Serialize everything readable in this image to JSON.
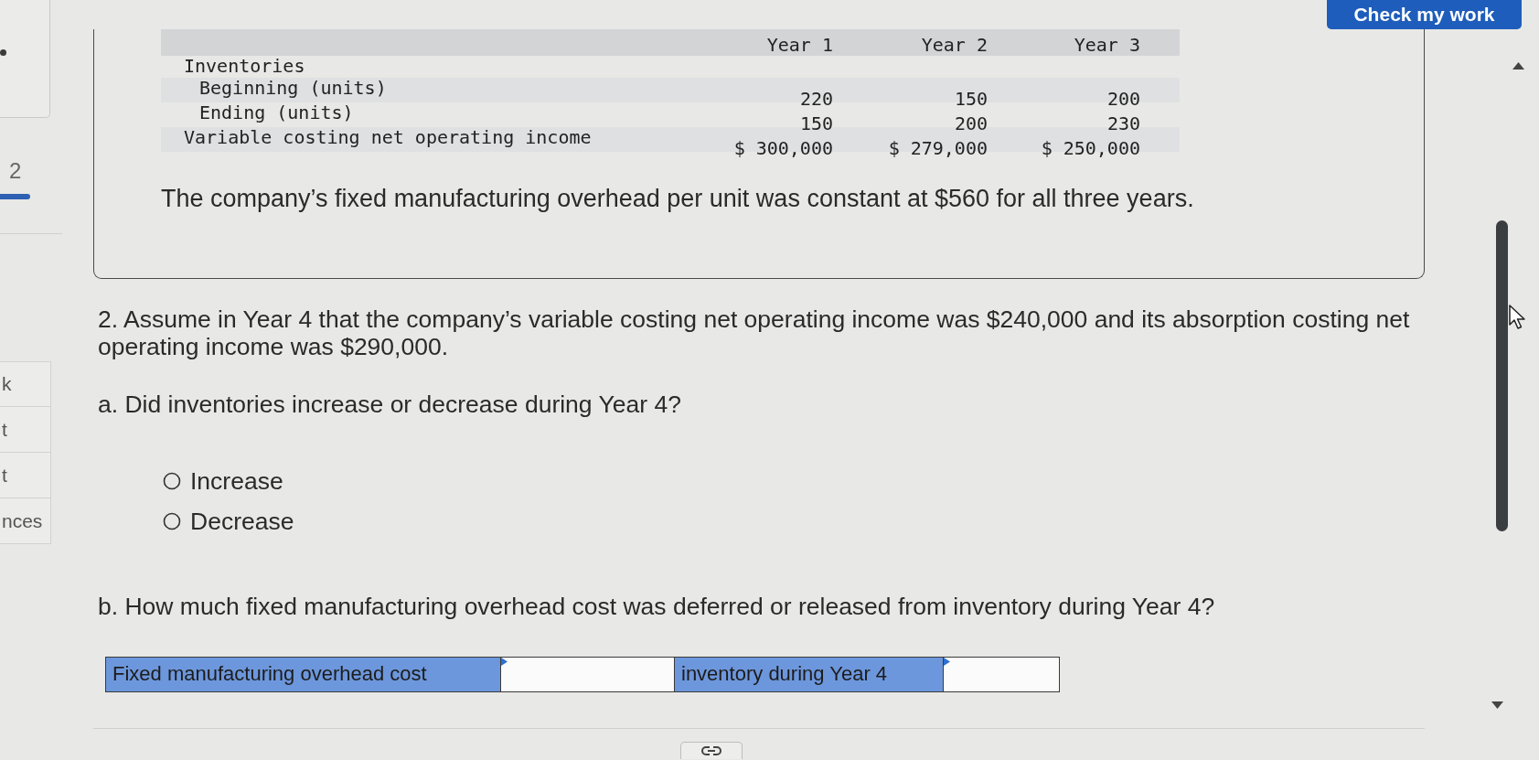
{
  "sidebar": {
    "page_indicator": "2",
    "links": [
      {
        "label": "k"
      },
      {
        "label": "t"
      },
      {
        "label": "t"
      },
      {
        "label": "nces"
      }
    ]
  },
  "toolbar": {
    "check_button": "Check my work"
  },
  "problem": {
    "table": {
      "columns": [
        "Year 1",
        "Year 2",
        "Year 3"
      ],
      "rows": [
        {
          "label": "Inventories",
          "children": [
            {
              "label": "Beginning (units)",
              "values": [
                "220",
                "150",
                "200"
              ]
            },
            {
              "label": "Ending (units)",
              "values": [
                "150",
                "200",
                "230"
              ]
            }
          ]
        },
        {
          "label": "Variable costing net operating income",
          "values": [
            "$ 300,000",
            "$ 279,000",
            "$ 250,000"
          ]
        }
      ]
    },
    "note": "The company’s fixed manufacturing overhead per unit was constant at $560 for all three years."
  },
  "question": {
    "text": "2. Assume in Year 4 that the company’s variable costing net operating income was $240,000 and its absorption costing net operating income was $290,000.",
    "part_a": {
      "prompt": "a. Did inventories increase or decrease during Year 4?",
      "options": [
        {
          "label": "Increase",
          "selected": false
        },
        {
          "label": "Decrease",
          "selected": false
        }
      ]
    },
    "part_b": {
      "prompt": "b. How much fixed manufacturing overhead cost was deferred or released from inventory during Year 4?",
      "answer_row": [
        {
          "kind": "label",
          "text": "Fixed manufacturing overhead cost"
        },
        {
          "kind": "field"
        },
        {
          "kind": "label",
          "text": "inventory during Year 4"
        },
        {
          "kind": "field"
        }
      ]
    }
  }
}
